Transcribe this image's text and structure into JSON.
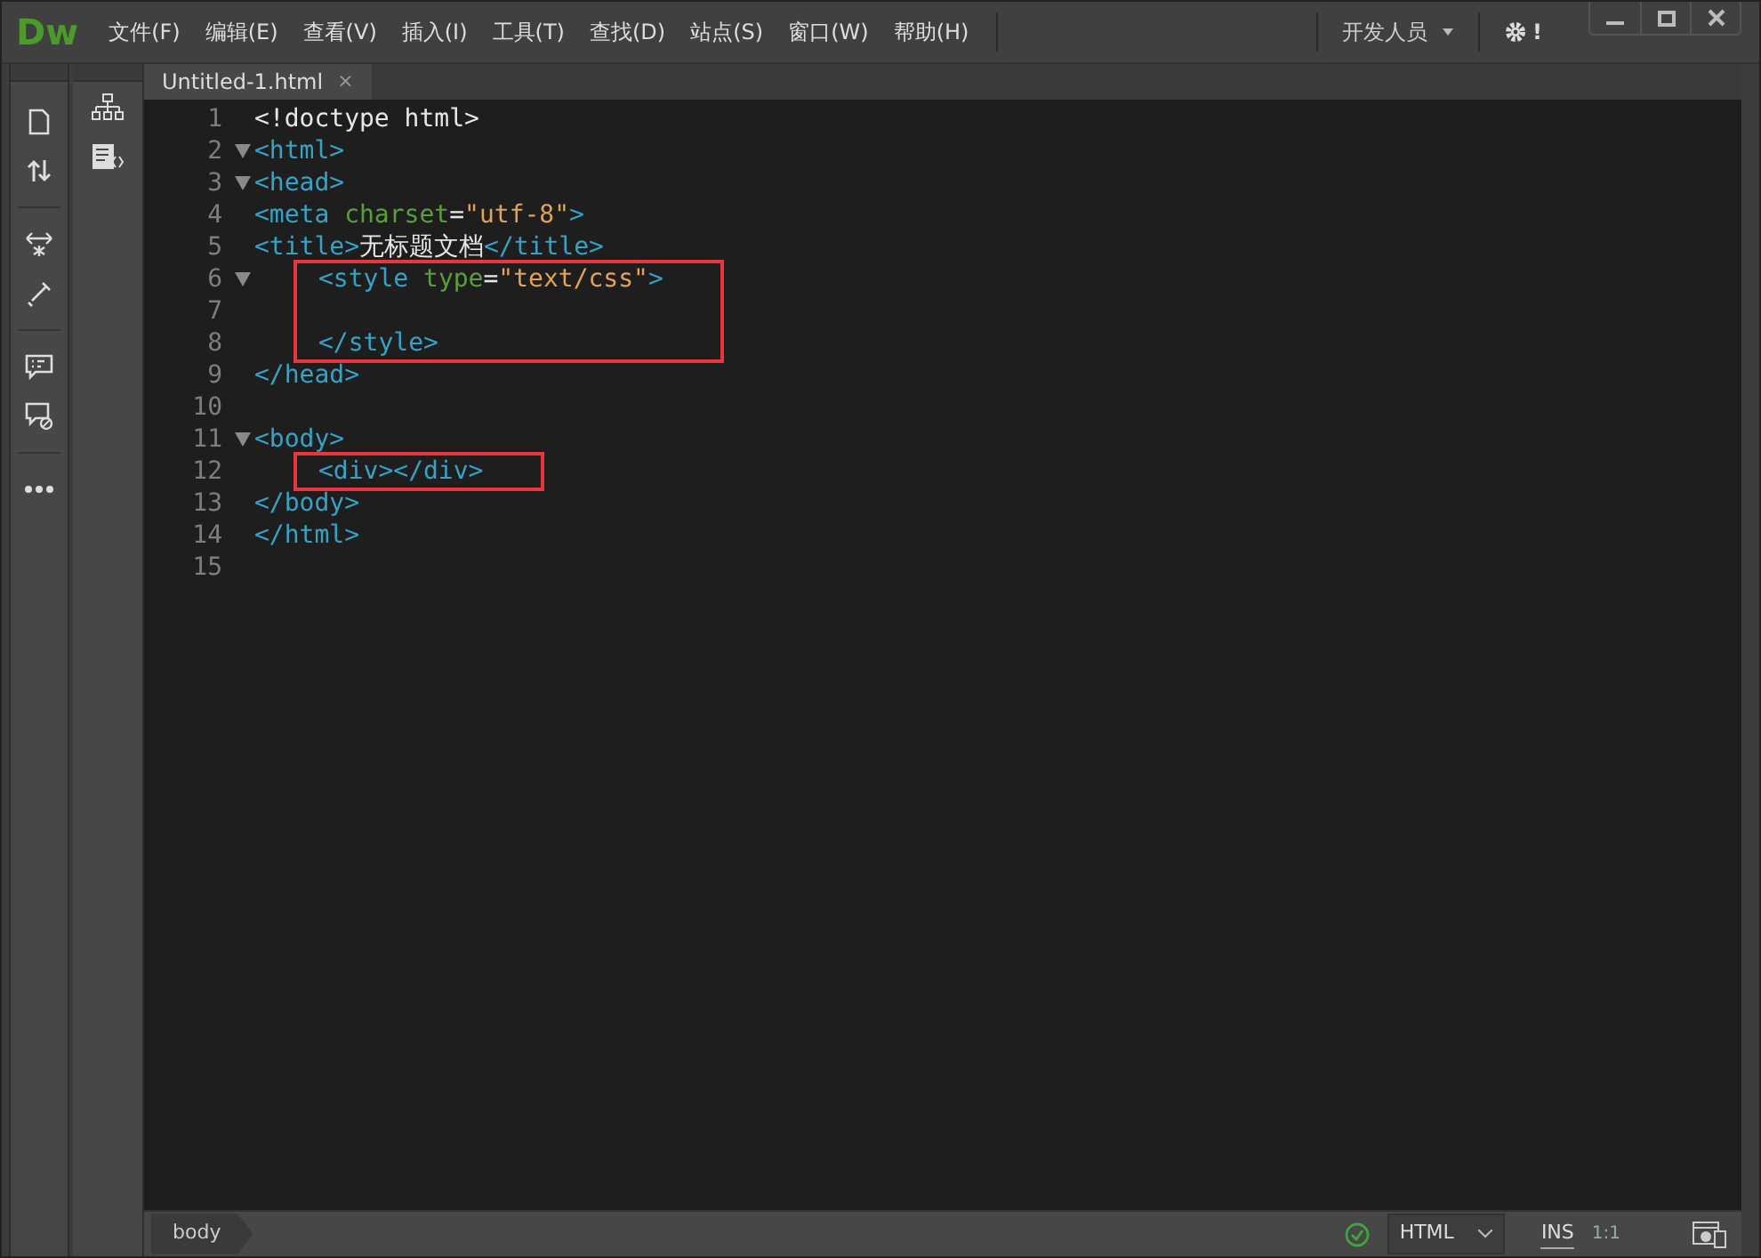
{
  "app": {
    "logo": "Dw"
  },
  "menu": [
    {
      "label": "文件(F)"
    },
    {
      "label": "编辑(E)"
    },
    {
      "label": "查看(V)"
    },
    {
      "label": "插入(I)"
    },
    {
      "label": "工具(T)"
    },
    {
      "label": "查找(D)"
    },
    {
      "label": "站点(S)"
    },
    {
      "label": "窗口(W)"
    },
    {
      "label": "帮助(H)"
    }
  ],
  "workspace": {
    "label": "开发人员",
    "alert": "!"
  },
  "tabs": [
    {
      "label": "Untitled-1.html",
      "close": "×",
      "selected": true
    }
  ],
  "code": {
    "blocks": [
      {
        "highlighted": false,
        "lines": [
          {
            "number": "1",
            "fold": false,
            "tokens": [
              {
                "kind": "plain",
                "text": "<!doctype html>"
              }
            ]
          },
          {
            "number": "2",
            "fold": true,
            "tokens": [
              {
                "kind": "tag",
                "text": "<html>"
              }
            ]
          },
          {
            "number": "3",
            "fold": true,
            "tokens": [
              {
                "kind": "tag",
                "text": "<head>"
              }
            ]
          },
          {
            "number": "4",
            "fold": false,
            "tokens": [
              {
                "kind": "tag",
                "text": "<meta "
              },
              {
                "kind": "attr",
                "text": "charset"
              },
              {
                "kind": "plain",
                "text": "="
              },
              {
                "kind": "value",
                "text": "\"utf-8\""
              },
              {
                "kind": "tag",
                "text": ">"
              }
            ]
          },
          {
            "number": "5",
            "fold": false,
            "tokens": [
              {
                "kind": "tag",
                "text": "<title>"
              },
              {
                "kind": "plain",
                "text": "无标题文档"
              },
              {
                "kind": "tag",
                "text": "</title>"
              }
            ]
          }
        ]
      },
      {
        "highlighted": true,
        "lines": [
          {
            "number": "6",
            "fold": true,
            "tokens": [
              {
                "kind": "tag",
                "text": "<style "
              },
              {
                "kind": "attr",
                "text": "type"
              },
              {
                "kind": "plain",
                "text": "="
              },
              {
                "kind": "value",
                "text": "\"text/css\""
              },
              {
                "kind": "tag",
                "text": ">"
              }
            ]
          },
          {
            "number": "7",
            "fold": false
          },
          {
            "number": "8",
            "fold": false,
            "tokens": [
              {
                "kind": "tag",
                "text": "</style>"
              }
            ]
          }
        ]
      },
      {
        "highlighted": false,
        "lines": [
          {
            "number": "9",
            "fold": false,
            "tokens": [
              {
                "kind": "tag",
                "text": "</head>"
              }
            ]
          },
          {
            "number": "10",
            "fold": false
          },
          {
            "number": "11",
            "fold": true,
            "tokens": [
              {
                "kind": "tag",
                "text": "<body>"
              }
            ]
          }
        ]
      },
      {
        "highlighted": true,
        "lines": [
          {
            "number": "12",
            "fold": false,
            "tokens": [
              {
                "kind": "tag",
                "text": "<div></div>"
              }
            ]
          }
        ]
      },
      {
        "highlighted": false,
        "lines": [
          {
            "number": "13",
            "fold": false,
            "tokens": [
              {
                "kind": "tag",
                "text": "</body>"
              }
            ]
          },
          {
            "number": "14",
            "fold": false,
            "tokens": [
              {
                "kind": "tag",
                "text": "</html>"
              }
            ]
          },
          {
            "number": "15",
            "fold": false
          }
        ]
      }
    ]
  },
  "status_bar": {
    "tag": "body",
    "language": "HTML",
    "mode": "INS",
    "position": "1:1"
  }
}
